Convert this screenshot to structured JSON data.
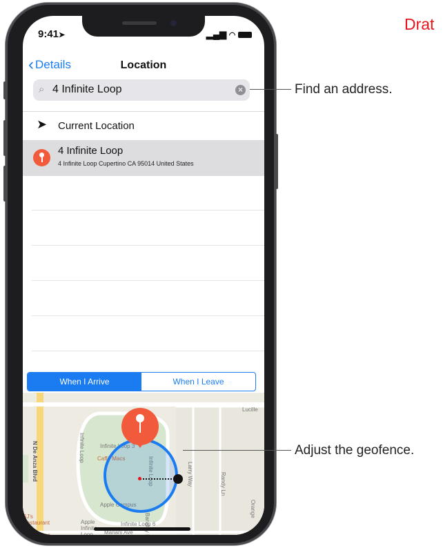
{
  "watermark": "Drat",
  "status_bar": {
    "time": "9:41",
    "icons": "▂▄▆ ▲ ▬"
  },
  "navbar": {
    "back_label": "Details",
    "title": "Location"
  },
  "search": {
    "value": "4 Infinite Loop"
  },
  "results": {
    "current_location": "Current Location",
    "selected_title": "4 Infinite Loop",
    "selected_subtitle": "4 Infinite Loop Cupertino CA 95014 United States"
  },
  "segment": {
    "arrive": "When I Arrive",
    "leave": "When I Leave",
    "selected": "arrive"
  },
  "map": {
    "labels": {
      "de_anza": "N De Anza Blvd",
      "infinite_loop_left": "Infinite Loop",
      "infinite_loop_3": "Infinite Loop 3",
      "cafe_macs": "Caffè Macs",
      "infinite_loop_vertical": "Infinite Loop",
      "apple_campus": "Apple Campus",
      "apple_infinite_loop": "Apple Infinite Loop",
      "infinite_loop_6": "Infinite Loop 6",
      "bjs": "BJ's Restaurant & Brewhouse",
      "mariani": "Mariani Ave",
      "larry_way": "Larry Way",
      "randy_ln": "Randy Ln",
      "bandley": "Bandley Dr",
      "lucille": "Lucille",
      "orange": "Orange"
    }
  },
  "callouts": {
    "find_address": "Find an address.",
    "adjust_geofence": "Adjust the geofence."
  },
  "colors": {
    "accent": "#1a7cf0",
    "pin": "#f15a3a",
    "watermark": "#e8141b"
  }
}
